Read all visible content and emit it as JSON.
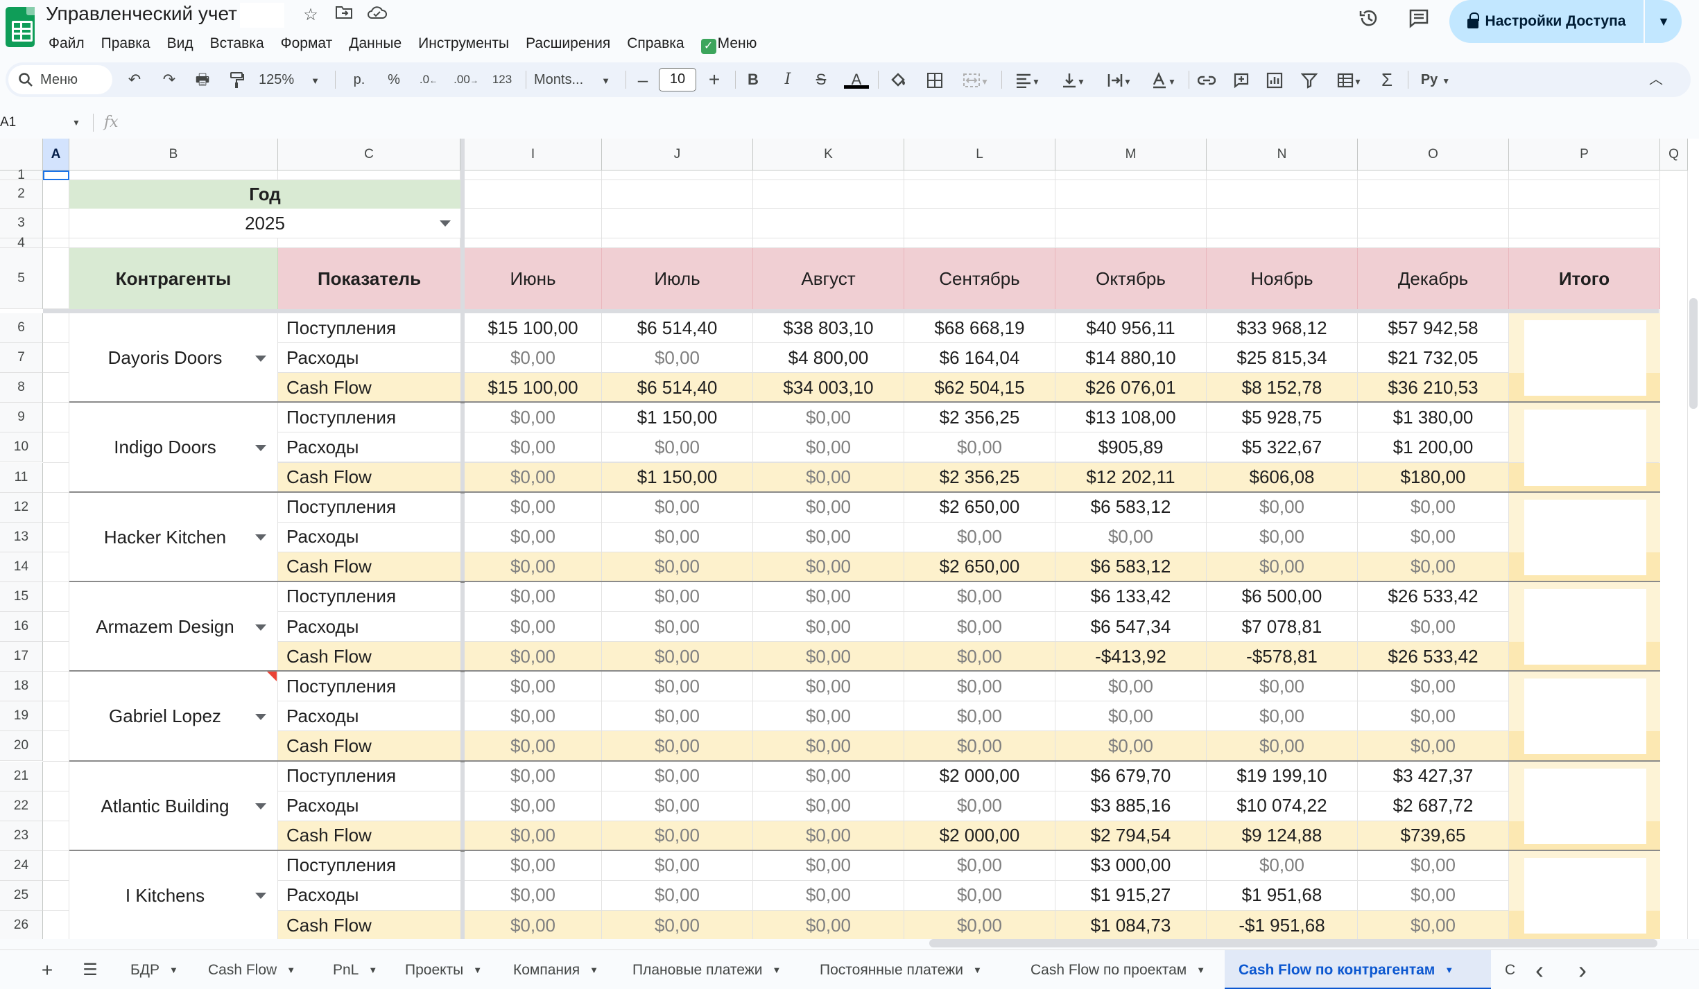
{
  "window": {
    "doc_title": "Управленческий учет",
    "share_label": "Настройки Доступа",
    "icons": [
      "star-icon",
      "move-to-folder-icon",
      "cloud-saved-icon",
      "history-icon",
      "comments-icon",
      "lock-icon"
    ]
  },
  "menu": [
    "Файл",
    "Правка",
    "Вид",
    "Вставка",
    "Формат",
    "Данные",
    "Инструменты",
    "Расширения",
    "Справка",
    "Меню"
  ],
  "toolbar": {
    "search_placeholder": "Меню",
    "zoom": "125%",
    "currency": "р.",
    "percent": "%",
    "dec_decrease": ".0",
    "dec_increase": ".00",
    "number_format": "123",
    "font": "Monts...",
    "font_size": "10",
    "script_label": "Ру"
  },
  "formula_bar": {
    "cell_ref": "A1",
    "fx": "fx",
    "value": ""
  },
  "columns": [
    "A",
    "B",
    "C",
    "I",
    "J",
    "K",
    "L",
    "M",
    "N",
    "O",
    "P",
    "Q"
  ],
  "rows": [
    "1",
    "2",
    "3",
    "4",
    "5",
    "6",
    "7",
    "8",
    "9",
    "10",
    "11",
    "12",
    "13",
    "14",
    "15",
    "16",
    "17",
    "18",
    "19",
    "20",
    "21",
    "22",
    "23",
    "24",
    "25",
    "26"
  ],
  "filter": {
    "year_label": "Год",
    "year_value": "2025"
  },
  "table": {
    "header_counterparty": "Контрагенты",
    "header_indicator": "Показатель",
    "months": [
      "Июнь",
      "Июль",
      "Август",
      "Сентябрь",
      "Октябрь",
      "Ноябрь",
      "Декабрь"
    ],
    "header_total": "Итого",
    "indicators": [
      "Поступления",
      "Расходы",
      "Cash Flow"
    ],
    "counterparties": [
      {
        "name": "Dayoris Doors",
        "values": [
          [
            "$15 100,00",
            "$6 514,40",
            "$38 803,10",
            "$68 668,19",
            "$40 956,11",
            "$33 968,12",
            "$57 942,58"
          ],
          [
            "$0,00",
            "$0,00",
            "$4 800,00",
            "$6 164,04",
            "$14 880,10",
            "$25 815,34",
            "$21 732,05"
          ],
          [
            "$15 100,00",
            "$6 514,40",
            "$34 003,10",
            "$62 504,15",
            "$26 076,01",
            "$8 152,78",
            "$36 210,53"
          ]
        ]
      },
      {
        "name": "Indigo Doors",
        "values": [
          [
            "$0,00",
            "$1 150,00",
            "$0,00",
            "$2 356,25",
            "$13 108,00",
            "$5 928,75",
            "$1 380,00"
          ],
          [
            "$0,00",
            "$0,00",
            "$0,00",
            "$0,00",
            "$905,89",
            "$5 322,67",
            "$1 200,00"
          ],
          [
            "$0,00",
            "$1 150,00",
            "$0,00",
            "$2 356,25",
            "$12 202,11",
            "$606,08",
            "$180,00"
          ]
        ]
      },
      {
        "name": "Hacker Kitchen",
        "values": [
          [
            "$0,00",
            "$0,00",
            "$0,00",
            "$2 650,00",
            "$6 583,12",
            "$0,00",
            "$0,00"
          ],
          [
            "$0,00",
            "$0,00",
            "$0,00",
            "$0,00",
            "$0,00",
            "$0,00",
            "$0,00"
          ],
          [
            "$0,00",
            "$0,00",
            "$0,00",
            "$2 650,00",
            "$6 583,12",
            "$0,00",
            "$0,00"
          ]
        ]
      },
      {
        "name": "Armazem Design",
        "values": [
          [
            "$0,00",
            "$0,00",
            "$0,00",
            "$0,00",
            "$6 133,42",
            "$6 500,00",
            "$26 533,42"
          ],
          [
            "$0,00",
            "$0,00",
            "$0,00",
            "$0,00",
            "$6 547,34",
            "$7 078,81",
            "$0,00"
          ],
          [
            "$0,00",
            "$0,00",
            "$0,00",
            "$0,00",
            "-$413,92",
            "-$578,81",
            "$26 533,42"
          ]
        ]
      },
      {
        "name": "Gabriel Lopez",
        "values": [
          [
            "$0,00",
            "$0,00",
            "$0,00",
            "$0,00",
            "$0,00",
            "$0,00",
            "$0,00"
          ],
          [
            "$0,00",
            "$0,00",
            "$0,00",
            "$0,00",
            "$0,00",
            "$0,00",
            "$0,00"
          ],
          [
            "$0,00",
            "$0,00",
            "$0,00",
            "$0,00",
            "$0,00",
            "$0,00",
            "$0,00"
          ]
        ]
      },
      {
        "name": "Atlantic Building",
        "values": [
          [
            "$0,00",
            "$0,00",
            "$0,00",
            "$2 000,00",
            "$6 679,70",
            "$19 199,10",
            "$3 427,37"
          ],
          [
            "$0,00",
            "$0,00",
            "$0,00",
            "$0,00",
            "$3 885,16",
            "$10 074,22",
            "$2 687,72"
          ],
          [
            "$0,00",
            "$0,00",
            "$0,00",
            "$2 000,00",
            "$2 794,54",
            "$9 124,88",
            "$739,65"
          ]
        ]
      },
      {
        "name": "I Kitchens",
        "values": [
          [
            "$0,00",
            "$0,00",
            "$0,00",
            "$0,00",
            "$3 000,00",
            "$0,00",
            "$0,00"
          ],
          [
            "$0,00",
            "$0,00",
            "$0,00",
            "$0,00",
            "$1 915,27",
            "$1 951,68",
            "$0,00"
          ],
          [
            "$0,00",
            "$0,00",
            "$0,00",
            "$0,00",
            "$1 084,73",
            "-$1 951,68",
            "$0,00"
          ]
        ]
      }
    ]
  },
  "sheet_tabs": [
    "БДР",
    "Cash Flow",
    "PnL",
    "Проекты",
    "Компания",
    "Плановые платежи",
    "Постоянные платежи",
    "Cash Flow по проектам",
    "Cash Flow по контрагентам",
    "С"
  ],
  "active_tab": "Cash Flow по контрагентам",
  "colors": {
    "header_green": "#d9ead3",
    "header_pink": "#f0cfd3",
    "cashflow_row": "#fdf1cc",
    "total_col": "#fce8b2",
    "share_button": "#c2e7ff",
    "active_tab": "#0b57d0"
  }
}
